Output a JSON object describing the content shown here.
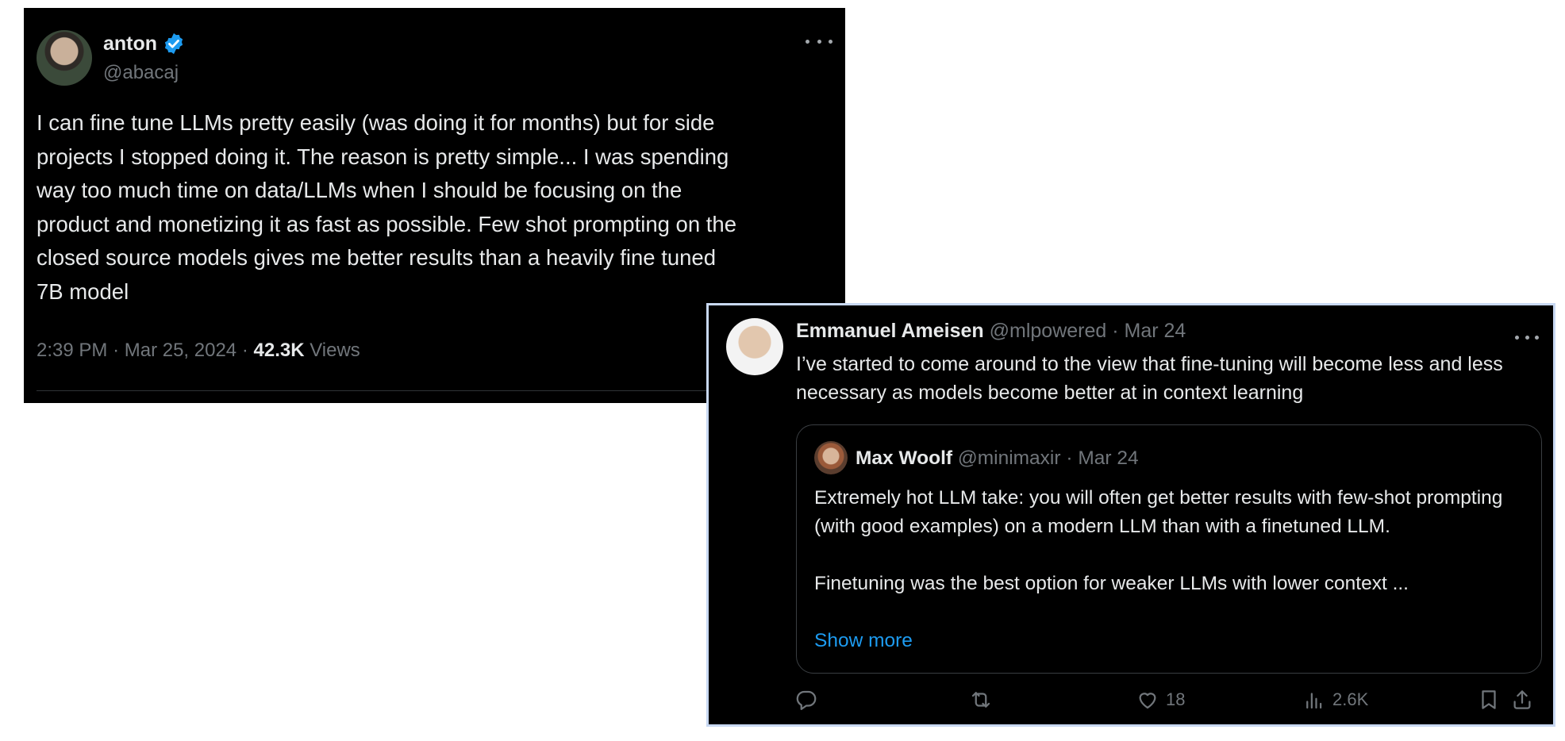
{
  "tweet1": {
    "author_name": "anton",
    "author_handle": "@abacaj",
    "text": "I can fine tune LLMs pretty easily (was doing it for months) but for side\nprojects I stopped doing it. The reason is pretty simple... I was spending\nway too much time on data/LLMs when I should be focusing on the\nproduct and monetizing it as fast as possible. Few shot prompting on the\nclosed source models gives me better results than a heavily fine tuned\n7B model",
    "time": "2:39 PM",
    "date": "Mar 25, 2024",
    "views_count": "42.3K",
    "views_label": "Views",
    "sep": "·",
    "verified_icon": "verified-badge-icon",
    "more_icon": "more-icon"
  },
  "tweet2": {
    "author_name": "Emmanuel Ameisen",
    "author_handle": "@mlpowered",
    "date": "Mar 24",
    "sep": "·",
    "text": "I’ve started to come around to the view that fine-tuning will become less and less necessary as models become better at in context learning",
    "quote": {
      "author_name": "Max Woolf",
      "author_handle": "@minimaxir",
      "date": "Mar 24",
      "text_p1": "Extremely hot LLM take: you will often get better results with few-shot prompting (with good examples) on a modern LLM than with a finetuned LLM.",
      "text_p2": "Finetuning was the best option for weaker LLMs with lower context ...",
      "show_more": "Show more"
    },
    "actions": {
      "likes": "18",
      "views": "2.6K"
    }
  },
  "colors": {
    "background": "#000000",
    "text": "#e7e9ea",
    "muted": "#71767b",
    "link": "#1d9bf0",
    "verified": "#1d9bf0",
    "highlight_border": "#c8d8f2"
  }
}
